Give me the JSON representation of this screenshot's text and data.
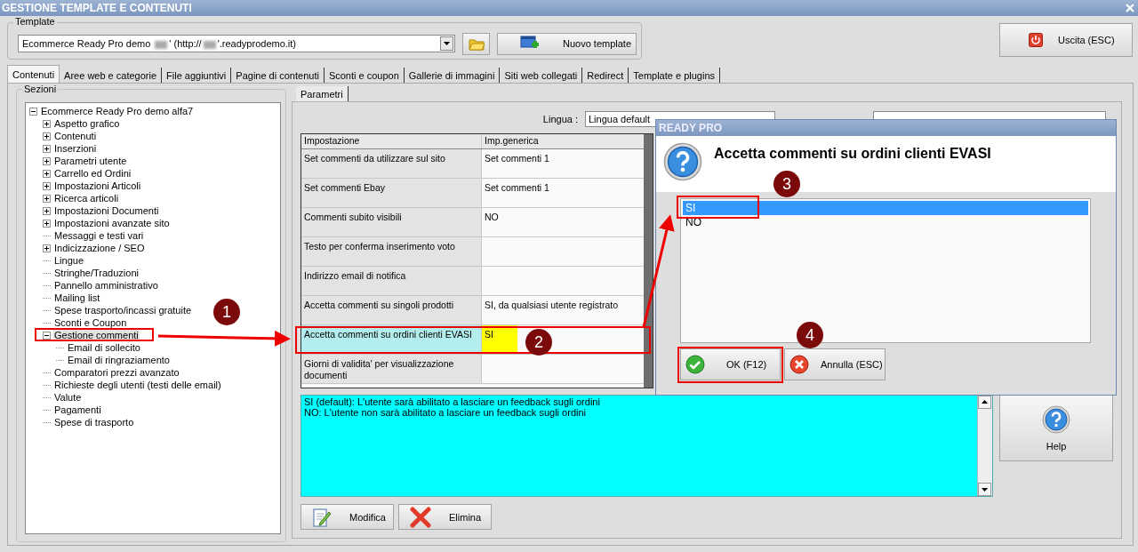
{
  "window": {
    "title": "GESTIONE TEMPLATE E CONTENUTI"
  },
  "template": {
    "label": "Template",
    "value_parts": [
      "Ecommerce Ready Pro demo ",
      "' (http://",
      "'.readyprodemo.it)"
    ],
    "new_button": "Nuovo template"
  },
  "exit_button": "Uscita (ESC)",
  "tabs": [
    {
      "label": "Contenuti",
      "selected": true
    },
    {
      "label": "Aree web e categorie",
      "selected": false
    },
    {
      "label": "File aggiuntivi",
      "selected": false
    },
    {
      "label": "Pagine di contenuti",
      "selected": false
    },
    {
      "label": "Sconti e coupon",
      "selected": false
    },
    {
      "label": "Gallerie di immagini",
      "selected": false
    },
    {
      "label": "Siti web collegati",
      "selected": false
    },
    {
      "label": "Redirect",
      "selected": false
    },
    {
      "label": "Template e plugins",
      "selected": false
    }
  ],
  "sections": {
    "label": "Sezioni",
    "tree": [
      {
        "label": "Ecommerce Ready Pro demo alfa7",
        "kind": "group",
        "expanded": true,
        "selected": false,
        "children": [
          {
            "label": "Aspetto grafico",
            "kind": "group",
            "expanded": false,
            "selected": false
          },
          {
            "label": "Contenuti",
            "kind": "group",
            "expanded": false,
            "selected": false
          },
          {
            "label": "Inserzioni",
            "kind": "group",
            "expanded": false,
            "selected": false
          },
          {
            "label": "Parametri utente",
            "kind": "group",
            "expanded": false,
            "selected": false
          },
          {
            "label": "Carrello ed Ordini",
            "kind": "group",
            "expanded": false,
            "selected": false
          },
          {
            "label": "Impostazioni Articoli",
            "kind": "group",
            "expanded": false,
            "selected": false
          },
          {
            "label": "Ricerca articoli",
            "kind": "group",
            "expanded": false,
            "selected": false
          },
          {
            "label": "Impostazioni Documenti",
            "kind": "group",
            "expanded": false,
            "selected": false
          },
          {
            "label": "Impostazioni avanzate sito",
            "kind": "group",
            "expanded": false,
            "selected": false
          },
          {
            "label": "Messaggi e testi vari",
            "kind": "leaf",
            "selected": false
          },
          {
            "label": "Indicizzazione / SEO",
            "kind": "group",
            "expanded": false,
            "selected": false
          },
          {
            "label": "Lingue",
            "kind": "leaf",
            "selected": false
          },
          {
            "label": "Stringhe/Traduzioni",
            "kind": "leaf",
            "selected": false
          },
          {
            "label": "Pannello amministrativo",
            "kind": "leaf",
            "selected": false
          },
          {
            "label": "Mailing list",
            "kind": "leaf",
            "selected": false
          },
          {
            "label": "Spese trasporto/incassi gratuite",
            "kind": "leaf",
            "selected": false
          },
          {
            "label": "Sconti e Coupon",
            "kind": "leaf",
            "selected": false
          },
          {
            "label": "Gestione commenti",
            "kind": "group",
            "expanded": true,
            "selected": true,
            "children": [
              {
                "label": "Email di sollecito",
                "kind": "leaf",
                "selected": false
              },
              {
                "label": "Email di ringraziamento",
                "kind": "leaf",
                "selected": false
              }
            ]
          },
          {
            "label": "Comparatori prezzi avanzato",
            "kind": "leaf",
            "selected": false
          },
          {
            "label": "Richieste degli utenti (testi delle email)",
            "kind": "leaf",
            "selected": false
          },
          {
            "label": "Valute",
            "kind": "leaf",
            "selected": false
          },
          {
            "label": "Pagamenti",
            "kind": "leaf",
            "selected": false
          },
          {
            "label": "Spese di trasporto",
            "kind": "leaf",
            "selected": false
          }
        ]
      }
    ]
  },
  "subtabs": [
    {
      "label": "Parametri",
      "selected": true
    }
  ],
  "language": {
    "label": "Lingua :",
    "value": "Lingua default"
  },
  "grid": {
    "columns": [
      "Impostazione",
      "Imp.generica"
    ],
    "rows": [
      {
        "setting": "Set commenti da utilizzare sul sito",
        "value": "Set commenti 1",
        "selected": false
      },
      {
        "setting": "Set commenti Ebay",
        "value": "Set commenti 1",
        "selected": false
      },
      {
        "setting": "Commenti subito visibili",
        "value": "NO",
        "selected": false
      },
      {
        "setting": "Testo per conferma inserimento voto",
        "value": "",
        "selected": false
      },
      {
        "setting": "Indirizzo email di notifica",
        "value": "",
        "selected": false
      },
      {
        "setting": "Accetta commenti su singoli prodotti",
        "value": "SI, da qualsiasi utente registrato",
        "selected": false
      },
      {
        "setting": "Accetta commenti su ordini clienti EVASI",
        "value": "SI",
        "selected": true
      },
      {
        "setting": "Giorni di validita' per visualizzazione documenti",
        "value": "",
        "selected": false
      }
    ]
  },
  "description": [
    "SI (default): L'utente sarà abilitato a lasciare un feedback sugli ordini",
    "NO: L'utente non sarà abilitato a lasciare un feedback sugli ordini"
  ],
  "help_button": "Help",
  "modify_button": "Modifica",
  "delete_button": "Elimina",
  "dialog": {
    "title": "READY PRO",
    "question": "Accetta commenti su ordini clienti EVASI",
    "options": [
      {
        "label": "SI",
        "selected": true
      },
      {
        "label": "NO",
        "selected": false
      }
    ],
    "ok_button": "OK (F12)",
    "cancel_button": "Annulla (ESC)"
  },
  "annotations": [
    {
      "label": "1"
    },
    {
      "label": "2"
    },
    {
      "label": "3"
    },
    {
      "label": "4"
    }
  ]
}
